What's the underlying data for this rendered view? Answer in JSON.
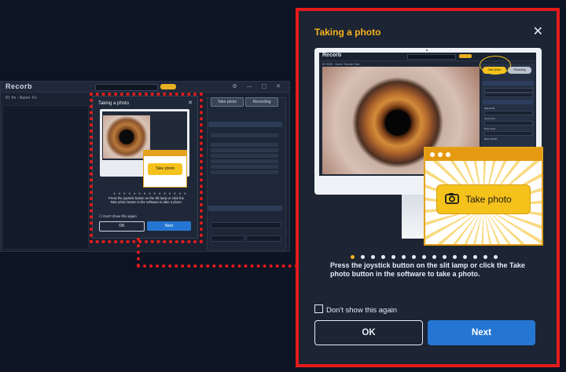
{
  "mini_app": {
    "logo": "Recorb",
    "breadcrumb": "ID: fm - Name: Fo",
    "tabs": [
      "Take photo",
      "Recording"
    ],
    "dialog_title": "Taking a photo",
    "take_photo_label": "Take photo",
    "instruction": "Press the joystick button on the slit lamp or click the Take photo button in the software to take a photo.",
    "dont_show": "Don't show this again",
    "ok": "OK",
    "next": "Next"
  },
  "dialog": {
    "title": "Taking a photo",
    "close_glyph": "✕",
    "illustration": {
      "app_logo": "Recorb",
      "take_photo_label": "Take photo"
    },
    "pagination": {
      "total": 15,
      "current": 1
    },
    "instruction": "Press the joystick button on the slit lamp or click the Take photo button in the software to take a photo.",
    "dont_show_label": "Don't show this again",
    "ok_label": "OK",
    "next_label": "Next"
  },
  "colors": {
    "accent_orange": "#f5b31e",
    "highlight_red": "#e51b1b",
    "primary_blue": "#2576d2",
    "button_yellow": "#f5c21b"
  },
  "icons": {
    "close": "close-icon",
    "camera": "camera-icon",
    "checkbox": "checkbox-icon"
  }
}
